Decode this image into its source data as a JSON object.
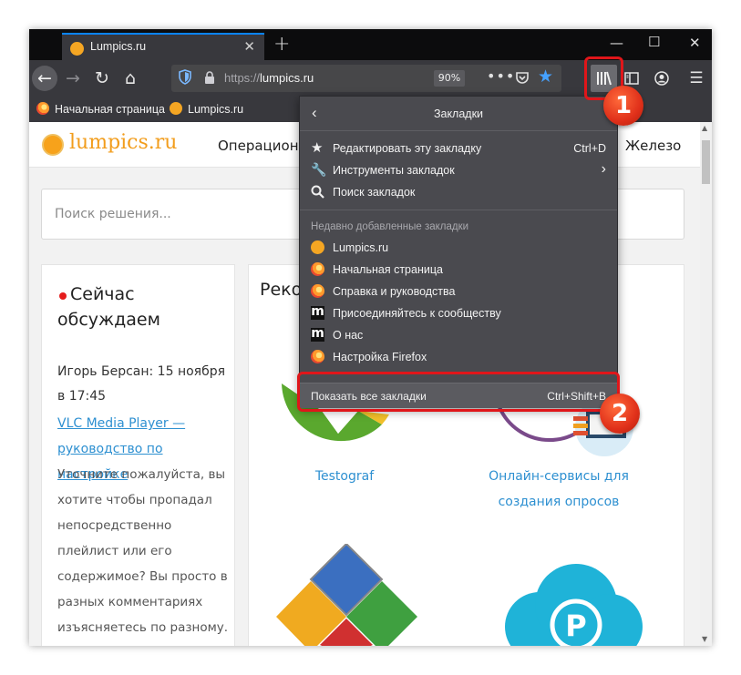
{
  "browser": {
    "tab_title": "Lumpics.ru",
    "url_prefix": "https://",
    "url_host": "lumpics.ru",
    "zoom": "90%",
    "bookmarks_bar": [
      "Начальная страница",
      "Lumpics.ru"
    ]
  },
  "site": {
    "logo": "lumpics.ru",
    "menu": [
      "Операционн",
      "Железо"
    ],
    "search_placeholder": "Поиск решения...",
    "discuss": {
      "title": "Сейчас обсуждаем",
      "author": "Игорь Берсан: 15 ноября в 17:45",
      "link": "VLC Media Player — руководство по настройке",
      "body": "Уточните пожалуйста, вы хотите чтобы пропадал непосредственно плейлист или его содержимое? Вы просто в разных комментариях изъясняетесь по разному. И на что нам обратить"
    },
    "reco_heading": "Реко",
    "cards": [
      "Testograf",
      "Онлайн-сервисы для создания опросов"
    ]
  },
  "panel": {
    "title": "Закладки",
    "items": [
      {
        "label": "Редактировать эту закладку",
        "shortcut": "Ctrl+D"
      },
      {
        "label": "Инструменты закладок",
        "shortcut": "›"
      },
      {
        "label": "Поиск закладок",
        "shortcut": ""
      }
    ],
    "recent_header": "Недавно добавленные закладки",
    "recent": [
      "Lumpics.ru",
      "Начальная страница",
      "Справка и руководства",
      "Присоединяйтесь к сообществу",
      "О нас",
      "Настройка Firefox"
    ],
    "show_all": "Показать все закладки",
    "show_all_shortcut": "Ctrl+Shift+B"
  },
  "annotations": [
    "1",
    "2"
  ],
  "colors": {
    "accent": "#0a84ff",
    "highlight": "#e0161a",
    "link": "#2e90d1",
    "logo": "#f29d1c"
  }
}
